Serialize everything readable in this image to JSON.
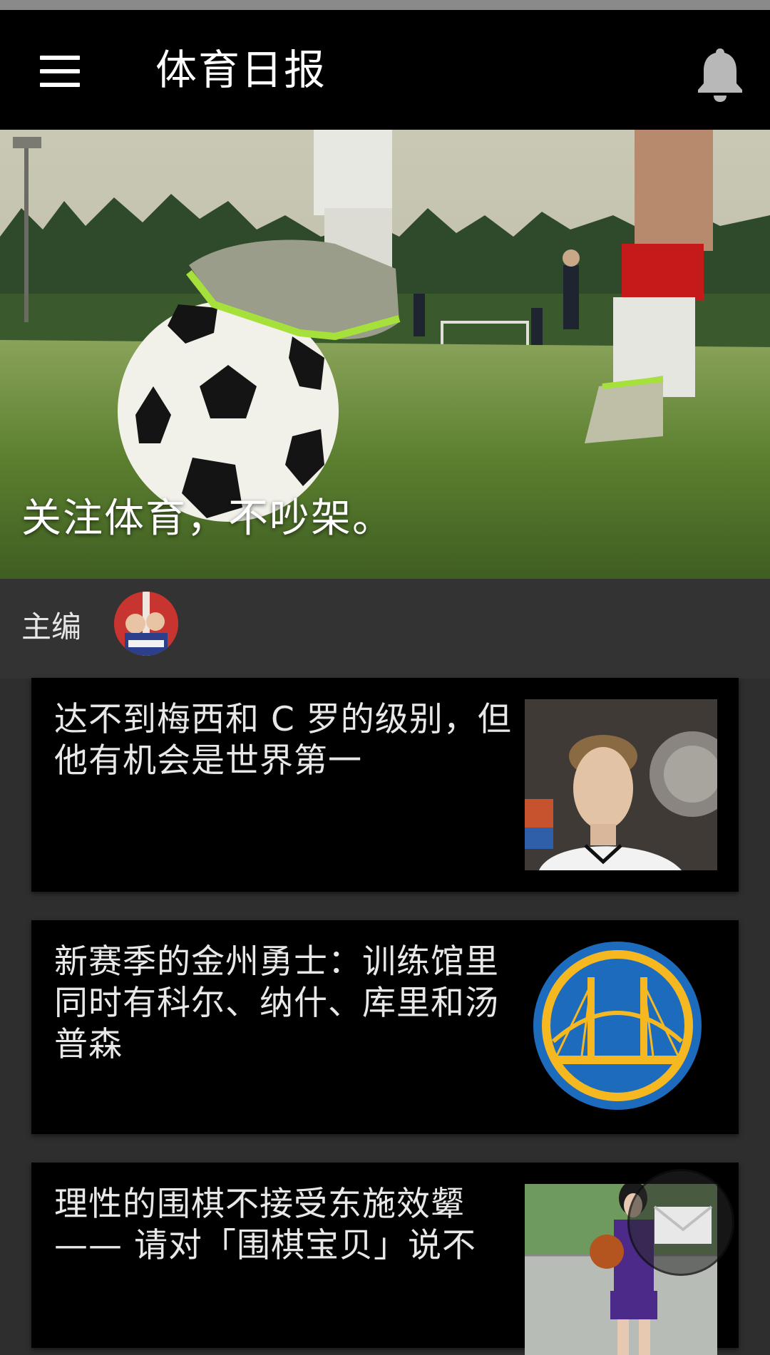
{
  "appbar": {
    "title": "体育日报",
    "menu_icon": "hamburger-menu-icon",
    "bell_icon": "bell-icon"
  },
  "hero": {
    "slogan": "关注体育，不吵架。"
  },
  "editor": {
    "label": "主编"
  },
  "articles": [
    {
      "title": "达不到梅西和 C 罗的级别，但他有机会是世界第一"
    },
    {
      "title": "新赛季的金州勇士：训练馆里同时有科尔、纳什、库里和汤普森"
    },
    {
      "title": "理性的围棋不接受东施效颦 —— 请对「围棋宝贝」说不"
    }
  ],
  "fab": {
    "icon": "mail-icon"
  },
  "colors": {
    "appbar_bg": "#000000",
    "page_bg": "#2e2e2e",
    "card_bg": "#000000",
    "text": "#e8e8e8"
  }
}
